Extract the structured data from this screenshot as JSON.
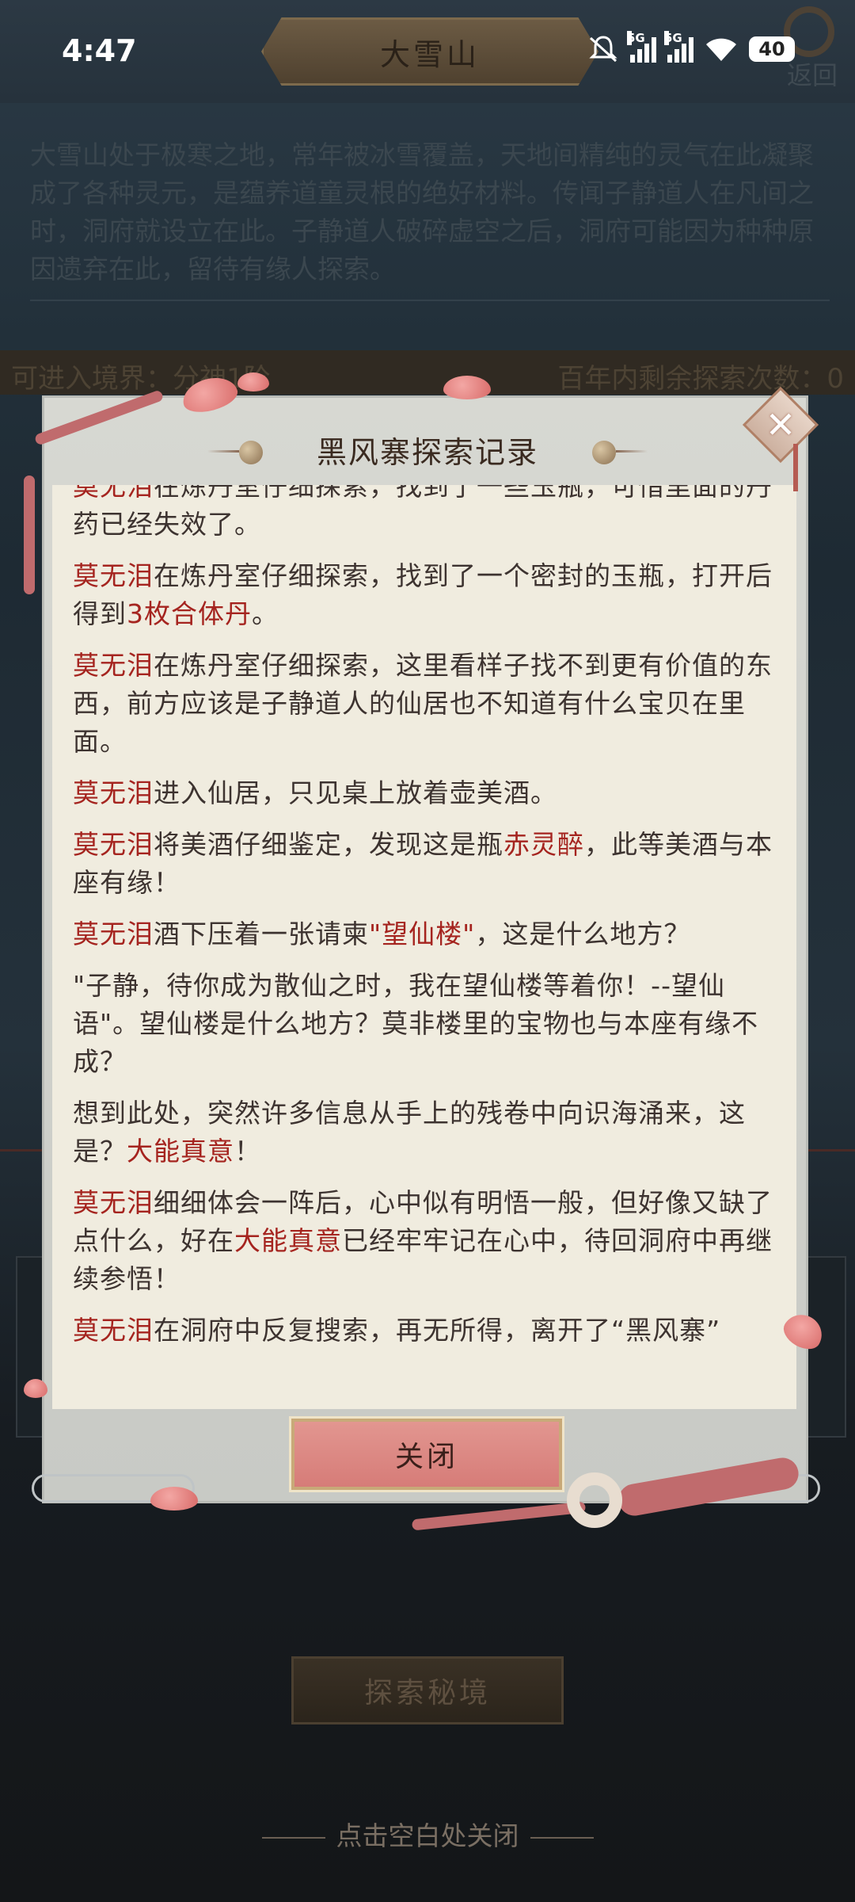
{
  "status_bar": {
    "time": "4:47",
    "network_1": "5G",
    "network_2": "5G",
    "battery": "40",
    "icons": [
      "mute-icon",
      "signal-icon",
      "signal-icon",
      "wifi-icon",
      "battery-icon"
    ]
  },
  "page": {
    "title": "大雪山",
    "back_label": "返回",
    "description": "大雪山处于极寒之地，常年被冰雪覆盖，天地间精纯的灵气在此凝聚成了各种灵元，是蕴养道童灵根的绝好材料。传闻子静道人在凡间之时，洞府就设立在此。子静道人破碎虚空之后，洞府可能因为种种原因遗弃在此，留待有缘人探索。",
    "realm_label": "可进入境界：",
    "realm_value": "分神1阶",
    "remaining_label": "百年内剩余探索次数：",
    "remaining_value": "0",
    "explore_button": "探索秘境",
    "dismiss_hint": "点击空白处关闭"
  },
  "modal": {
    "title": "黑风寨探索记录",
    "close_button": "关闭",
    "entries": [
      {
        "segments": [
          {
            "t": "莫无泪",
            "h": true
          },
          {
            "t": "在炼丹室仔细探索，找到了一些玉瓶，可惜里面的丹药已经失效了。",
            "h": false
          }
        ]
      },
      {
        "segments": [
          {
            "t": "莫无泪",
            "h": true
          },
          {
            "t": "在炼丹室仔细探索，找到了一个密封的玉瓶，打开后得到",
            "h": false
          },
          {
            "t": "3枚合体丹",
            "h": true
          },
          {
            "t": "。",
            "h": false
          }
        ]
      },
      {
        "segments": [
          {
            "t": "莫无泪",
            "h": true
          },
          {
            "t": "在炼丹室仔细探索，这里看样子找不到更有价值的东西，前方应该是子静道人的仙居也不知道有什么宝贝在里面。",
            "h": false
          }
        ]
      },
      {
        "segments": [
          {
            "t": "莫无泪",
            "h": true
          },
          {
            "t": "进入仙居，只见桌上放着壶美酒。",
            "h": false
          }
        ]
      },
      {
        "segments": [
          {
            "t": "莫无泪",
            "h": true
          },
          {
            "t": "将美酒仔细鉴定，发现这是瓶",
            "h": false
          },
          {
            "t": "赤灵醉",
            "h": true
          },
          {
            "t": "，此等美酒与本座有缘！",
            "h": false
          }
        ]
      },
      {
        "segments": [
          {
            "t": "莫无泪",
            "h": true
          },
          {
            "t": "酒下压着一张请柬",
            "h": false
          },
          {
            "t": "\"望仙楼\"",
            "h": true
          },
          {
            "t": "，这是什么地方？",
            "h": false
          }
        ]
      },
      {
        "segments": [
          {
            "t": "\"子静，待你成为散仙之时，我在望仙楼等着你！--望仙语\"。望仙楼是什么地方？莫非楼里的宝物也与本座有缘不成？",
            "h": false
          }
        ]
      },
      {
        "segments": [
          {
            "t": "想到此处，突然许多信息从手上的残卷中向识海涌来，这是？",
            "h": false
          },
          {
            "t": "大能真意",
            "h": true
          },
          {
            "t": "！",
            "h": false
          }
        ]
      },
      {
        "segments": [
          {
            "t": "莫无泪",
            "h": true
          },
          {
            "t": "细细体会一阵后，心中似有明悟一般，但好像又缺了点什么，好在",
            "h": false
          },
          {
            "t": "大能真意",
            "h": true
          },
          {
            "t": "已经牢牢记在心中，待回洞府中再继续参悟！",
            "h": false
          }
        ]
      },
      {
        "segments": [
          {
            "t": "莫无泪",
            "h": true
          },
          {
            "t": "在洞府中反复搜索，再无所得，离开了“黑风寨”",
            "h": false
          }
        ]
      }
    ]
  },
  "colors": {
    "highlight": "#a5241f",
    "body_text": "#3d3330",
    "close_button": "#d98580",
    "parchment": "#f0ecdf"
  }
}
